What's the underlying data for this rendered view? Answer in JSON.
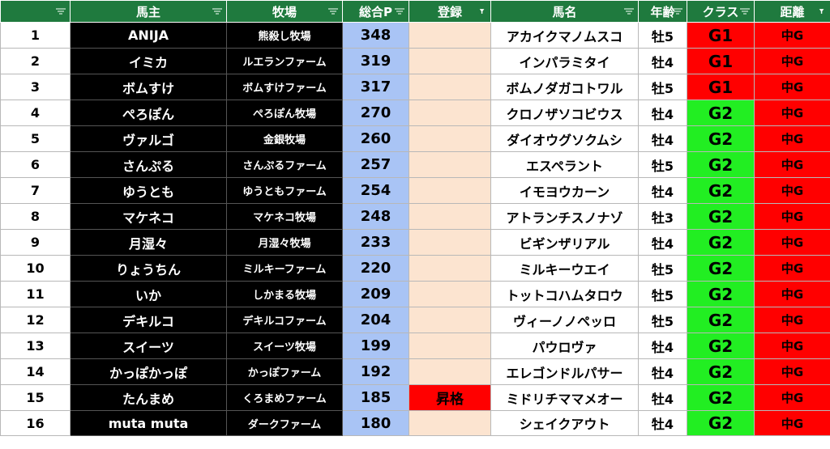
{
  "headers": [
    {
      "label": "",
      "filter": "sort"
    },
    {
      "label": "馬主",
      "filter": "sort"
    },
    {
      "label": "牧場",
      "filter": "sort"
    },
    {
      "label": "総合P",
      "filter": "sort"
    },
    {
      "label": "登録",
      "filter": "active"
    },
    {
      "label": "馬名",
      "filter": "sort"
    },
    {
      "label": "年齢",
      "filter": "sort"
    },
    {
      "label": "クラス",
      "filter": "sort"
    },
    {
      "label": "距離",
      "filter": "active"
    }
  ],
  "rows": [
    {
      "rank": "1",
      "owner": "ANIJA",
      "farm": "熊殺し牧場",
      "points": "348",
      "reg": "",
      "horse": "アカイクマノムスコ",
      "age": "牡5",
      "cls": "G1",
      "dist": "中G"
    },
    {
      "rank": "2",
      "owner": "イミカ",
      "farm": "ルエランファーム",
      "points": "319",
      "reg": "",
      "horse": "インパラミタイ",
      "age": "牡4",
      "cls": "G1",
      "dist": "中G"
    },
    {
      "rank": "3",
      "owner": "ボムすけ",
      "farm": "ボムすけファーム",
      "points": "317",
      "reg": "",
      "horse": "ボムノダガコトワル",
      "age": "牡5",
      "cls": "G1",
      "dist": "中G"
    },
    {
      "rank": "4",
      "owner": "ぺろぽん",
      "farm": "ぺろぽん牧場",
      "points": "270",
      "reg": "",
      "horse": "クロノザソコビウス",
      "age": "牡4",
      "cls": "G2",
      "dist": "中G"
    },
    {
      "rank": "5",
      "owner": "ヴァルゴ",
      "farm": "金銀牧場",
      "points": "260",
      "reg": "",
      "horse": "ダイオウグソクムシ",
      "age": "牡4",
      "cls": "G2",
      "dist": "中G"
    },
    {
      "rank": "6",
      "owner": "さんぷる",
      "farm": "さんぷるファーム",
      "points": "257",
      "reg": "",
      "horse": "エスペラント",
      "age": "牡5",
      "cls": "G2",
      "dist": "中G"
    },
    {
      "rank": "7",
      "owner": "ゆうとも",
      "farm": "ゆうともファーム",
      "points": "254",
      "reg": "",
      "horse": "イモヨウカーン",
      "age": "牡4",
      "cls": "G2",
      "dist": "中G"
    },
    {
      "rank": "8",
      "owner": "マケネコ",
      "farm": "マケネコ牧場",
      "points": "248",
      "reg": "",
      "horse": "アトランチスノナゾ",
      "age": "牡3",
      "cls": "G2",
      "dist": "中G"
    },
    {
      "rank": "9",
      "owner": "月湿々",
      "farm": "月湿々牧場",
      "points": "233",
      "reg": "",
      "horse": "ビギンザリアル",
      "age": "牡4",
      "cls": "G2",
      "dist": "中G"
    },
    {
      "rank": "10",
      "owner": "りょうちん",
      "farm": "ミルキーファーム",
      "points": "220",
      "reg": "",
      "horse": "ミルキーウエイ",
      "age": "牡5",
      "cls": "G2",
      "dist": "中G"
    },
    {
      "rank": "11",
      "owner": "いか",
      "farm": "しかまる牧場",
      "points": "209",
      "reg": "",
      "horse": "トットコハムタロウ",
      "age": "牡5",
      "cls": "G2",
      "dist": "中G"
    },
    {
      "rank": "12",
      "owner": "デキルコ",
      "farm": "デキルコファーム",
      "points": "204",
      "reg": "",
      "horse": "ヴィーノノペッロ",
      "age": "牡5",
      "cls": "G2",
      "dist": "中G"
    },
    {
      "rank": "13",
      "owner": "スイーツ",
      "farm": "スイーツ牧場",
      "points": "199",
      "reg": "",
      "horse": "パウロヴァ",
      "age": "牡4",
      "cls": "G2",
      "dist": "中G"
    },
    {
      "rank": "14",
      "owner": "かっぽかっぽ",
      "farm": "かっぽファーム",
      "points": "192",
      "reg": "",
      "horse": "エレゴンドルパサー",
      "age": "牡4",
      "cls": "G2",
      "dist": "中G"
    },
    {
      "rank": "15",
      "owner": "たんまめ",
      "farm": "くろまめファーム",
      "points": "185",
      "reg": "昇格",
      "horse": "ミドリチママメオー",
      "age": "牡4",
      "cls": "G2",
      "dist": "中G"
    },
    {
      "rank": "16",
      "owner": "muta muta",
      "farm": "ダークファーム",
      "points": "180",
      "reg": "",
      "horse": "シェイクアウト",
      "age": "牡4",
      "cls": "G2",
      "dist": "中G"
    }
  ],
  "colors": {
    "header_bg": "#1f7a3e",
    "points_bg": "#a9c4f5",
    "reg_bg": "#fce4d0",
    "promo_bg": "#ff0000",
    "g1_bg": "#ff0000",
    "g2_bg": "#22ee22",
    "dist_bg": "#ff0000"
  }
}
